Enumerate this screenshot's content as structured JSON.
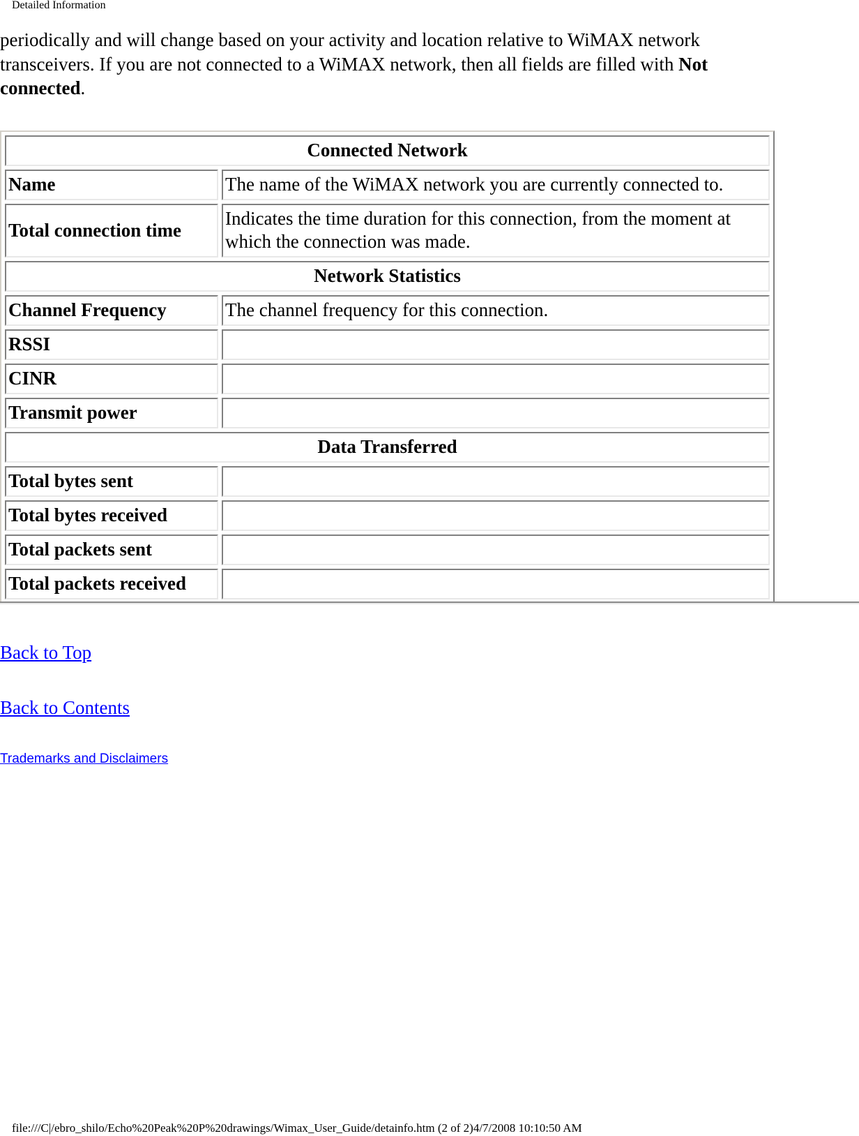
{
  "header": {
    "title": "Detailed Information"
  },
  "intro": {
    "text_before": "periodically and will change based on your activity and location relative to WiMAX network transceivers. If you are not connected to a WiMAX network, then all fields are filled with ",
    "bold": "Not connected",
    "text_after": "."
  },
  "table": {
    "sections": [
      {
        "title": "Connected Network",
        "rows": [
          {
            "label": "Name",
            "value": "The name of the WiMAX network you are currently connected to."
          },
          {
            "label": "Total connection time",
            "value": "Indicates the time duration for this connection, from the moment at which the connection was made."
          }
        ]
      },
      {
        "title": "Network Statistics",
        "rows": [
          {
            "label": "Channel Frequency",
            "value": "The channel frequency for this connection."
          },
          {
            "label": "RSSI",
            "value": ""
          },
          {
            "label": "CINR",
            "value": ""
          },
          {
            "label": "Transmit power",
            "value": ""
          }
        ]
      },
      {
        "title": "Data Transferred",
        "rows": [
          {
            "label": "Total bytes sent",
            "value": ""
          },
          {
            "label": "Total bytes received",
            "value": ""
          },
          {
            "label": "Total packets sent",
            "value": ""
          },
          {
            "label": "Total packets received",
            "value": ""
          }
        ]
      }
    ]
  },
  "links": {
    "back_to_top": "Back to Top",
    "back_to_contents": "Back to Contents",
    "trademarks": "Trademarks and Disclaimers"
  },
  "footer": {
    "path": "file:///C|/ebro_shilo/Echo%20Peak%20P%20drawings/Wimax_User_Guide/detainfo.htm (2 of 2)4/7/2008 10:10:50 AM"
  },
  "colors": {
    "link": "#0000ff"
  }
}
